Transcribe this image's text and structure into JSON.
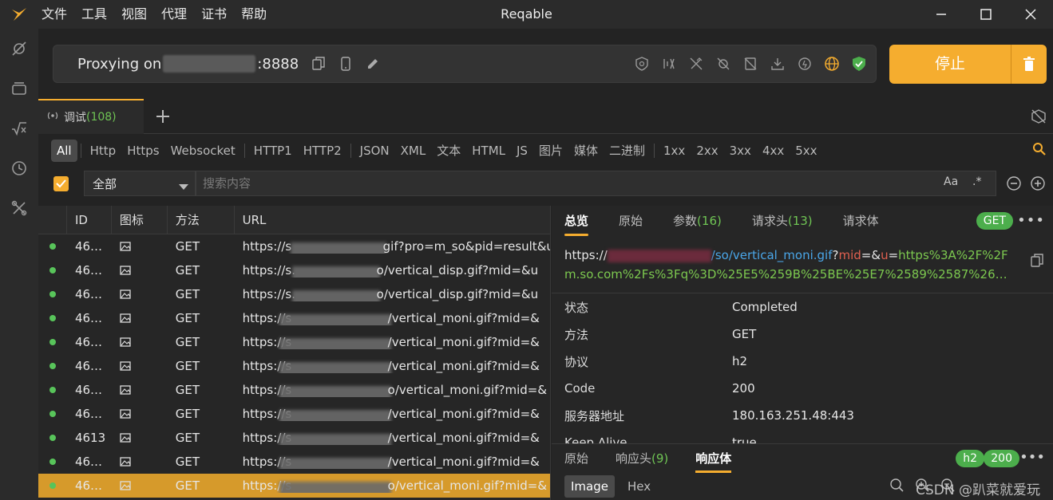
{
  "app": {
    "title": "Reqable"
  },
  "menu": [
    "文件",
    "工具",
    "视图",
    "代理",
    "证书",
    "帮助"
  ],
  "proxy": {
    "prefix": "Proxying on",
    "port": ":8888"
  },
  "stop_button": {
    "label": "停止"
  },
  "tabs": [
    {
      "label": "调试",
      "count": "(108)"
    }
  ],
  "filters": {
    "protocols": [
      "All",
      "Http",
      "Https",
      "Websocket"
    ],
    "versions": [
      "HTTP1",
      "HTTP2"
    ],
    "types": [
      "JSON",
      "XML",
      "文本",
      "HTML",
      "JS",
      "图片",
      "媒体",
      "二进制"
    ],
    "codes": [
      "1xx",
      "2xx",
      "3xx",
      "4xx",
      "5xx"
    ],
    "active": "All"
  },
  "search": {
    "scope": "全部",
    "placeholder": "搜索内容",
    "case_label": "Aa",
    "regex_label": ".*"
  },
  "table": {
    "headers": {
      "id": "ID",
      "icon": "图标",
      "method": "方法",
      "url": "URL"
    },
    "rows": [
      {
        "id": "46…",
        "method": "GET",
        "url_start": "https://s",
        "url_end": "gif?pro=m_so&pid=result&u"
      },
      {
        "id": "46…",
        "method": "GET",
        "url_start": "https://s.",
        "url_end": "o/vertical_disp.gif?mid=&u"
      },
      {
        "id": "46…",
        "method": "GET",
        "url_start": "https://s.",
        "url_end": "o/vertical_disp.gif?mid=&u"
      },
      {
        "id": "46…",
        "method": "GET",
        "url_start": "https://s",
        "url_end": "/vertical_moni.gif?mid=&"
      },
      {
        "id": "46…",
        "method": "GET",
        "url_start": "https://s",
        "url_end": "/vertical_moni.gif?mid=&"
      },
      {
        "id": "46…",
        "method": "GET",
        "url_start": "https://s",
        "url_end": "/vertical_moni.gif?mid=&"
      },
      {
        "id": "46…",
        "method": "GET",
        "url_start": "https://s",
        "url_end": "o/vertical_moni.gif?mid=&"
      },
      {
        "id": "46…",
        "method": "GET",
        "url_start": "https://s",
        "url_end": "/vertical_moni.gif?mid=&"
      },
      {
        "id": "4613",
        "method": "GET",
        "url_start": "https://s",
        "url_end": "/vertical_moni.gif?mid=&"
      },
      {
        "id": "46…",
        "method": "GET",
        "url_start": "https://s",
        "url_end": "/vertical_moni.gif?mid=&"
      },
      {
        "id": "46…",
        "method": "GET",
        "url_start": "https://s",
        "url_end": "o/vertical_moni.gif?mid=&"
      }
    ],
    "selected_index": 10
  },
  "detail": {
    "tabs": [
      {
        "label": "总览",
        "count": ""
      },
      {
        "label": "原始",
        "count": ""
      },
      {
        "label": "参数",
        "count": "(16)"
      },
      {
        "label": "请求头",
        "count": "(13)"
      },
      {
        "label": "请求体",
        "count": ""
      }
    ],
    "method_badge": "GET",
    "url": {
      "scheme": "https://",
      "path": "/so/vertical_moni.gif",
      "q": "?",
      "k1": "mid",
      "eq1": "=&",
      "k2": "u",
      "eq2": "=",
      "v2": "https%3A%2F%2F",
      "line2": "m.so.com%2Fs%3Fq%3D%25E5%259B%25BE%25E7%2589%2587%26…"
    },
    "fields": [
      {
        "key": "状态",
        "value": "Completed"
      },
      {
        "key": "方法",
        "value": "GET"
      },
      {
        "key": "协议",
        "value": "h2"
      },
      {
        "key": "Code",
        "value": "200"
      },
      {
        "key": "服务器地址",
        "value": "180.163.251.48:443"
      },
      {
        "key": "Keep Alive",
        "value": "true"
      }
    ],
    "response_tabs": [
      {
        "label": "原始",
        "count": ""
      },
      {
        "label": "响应头",
        "count": "(9)"
      },
      {
        "label": "响应体",
        "count": ""
      }
    ],
    "protocol_badge": "h2",
    "code_badge": "200",
    "view_modes": [
      "Image",
      "Hex"
    ],
    "watermark": "CSDN @趴菜就爱玩"
  },
  "colors": {
    "accent": "#f5ad2f",
    "success": "#4cae4c",
    "count": "#6fc454"
  }
}
